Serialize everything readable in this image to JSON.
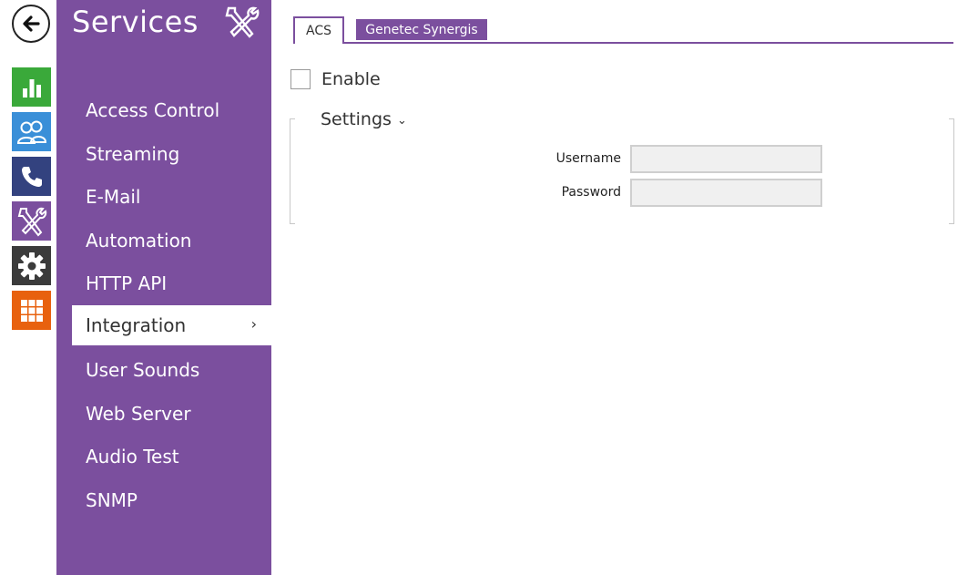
{
  "rail": {
    "back_icon": "arrow-left-icon",
    "items": [
      {
        "name": "status",
        "icon": "bar-chart-icon",
        "color": "#3aa93a"
      },
      {
        "name": "directory",
        "icon": "users-icon",
        "color": "#3a8fd8"
      },
      {
        "name": "calls",
        "icon": "phone-icon",
        "color": "#33427f"
      },
      {
        "name": "services",
        "icon": "tools-icon",
        "color": "#7b4f9e"
      },
      {
        "name": "hardware",
        "icon": "gear-icon",
        "color": "#3b3b3b"
      },
      {
        "name": "system",
        "icon": "grid-icon",
        "color": "#e8610e"
      }
    ]
  },
  "sidebar": {
    "title": "Services",
    "title_icon": "tools-icon",
    "items": [
      {
        "label": "Access Control"
      },
      {
        "label": "Streaming"
      },
      {
        "label": "E-Mail"
      },
      {
        "label": "Automation"
      },
      {
        "label": "HTTP API"
      },
      {
        "label": "Integration",
        "active": true,
        "chevron": "›"
      },
      {
        "label": "User Sounds"
      },
      {
        "label": "Web Server"
      },
      {
        "label": "Audio Test"
      },
      {
        "label": "SNMP"
      }
    ]
  },
  "tabs": [
    {
      "label": "ACS",
      "active": true
    },
    {
      "label": "Genetec Synergis",
      "active": false
    }
  ],
  "enable": {
    "label": "Enable",
    "checked": false
  },
  "settings": {
    "legend": "Settings",
    "caret": "⌄",
    "fields": [
      {
        "label": "Username",
        "value": ""
      },
      {
        "label": "Password",
        "value": ""
      }
    ]
  },
  "colors": {
    "accent": "#7b4f9e"
  }
}
